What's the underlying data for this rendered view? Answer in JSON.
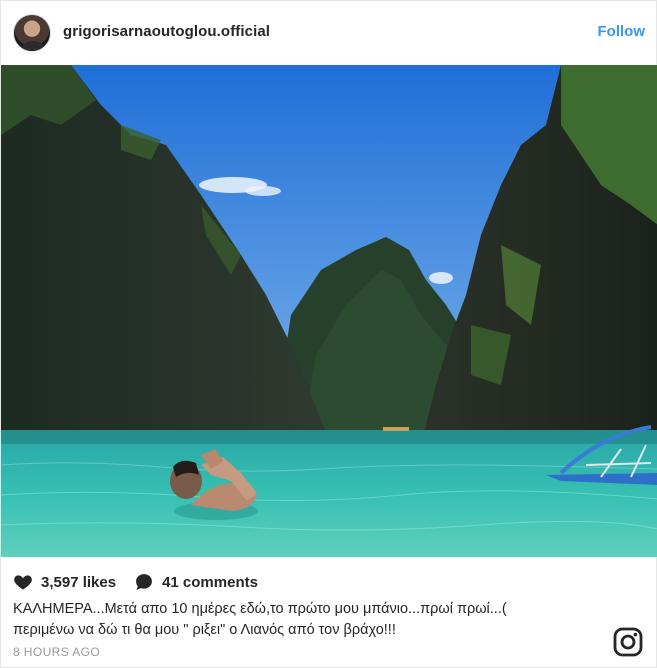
{
  "post": {
    "username": "grigorisarnaoutoglou.official",
    "follow_label": "Follow",
    "likes": "3,597 likes",
    "comments": "41 comments",
    "caption_line1": "ΚΑΛΗΜΕΡΑ...Μετά απο 10 ημέρες εδώ,το πρώτο μου μπάνιο...πρωί πρωί...(",
    "caption_line2": "περιμένω να δώ τι θα μου \" ριξει\" ο Λιανός από τον βράχο!!!",
    "time_ago": "8 HOURS AGO"
  },
  "icons": {
    "like": "heart-icon",
    "comment": "comment-bubble-icon",
    "brand": "instagram-logo-icon"
  },
  "colors": {
    "accent": "#3897f0",
    "text": "#262626",
    "muted": "#999999"
  }
}
